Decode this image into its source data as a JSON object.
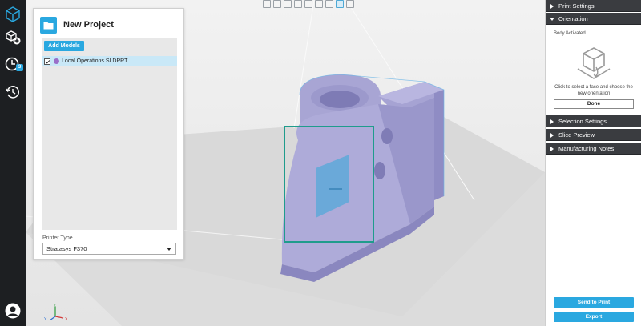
{
  "project": {
    "title": "New Project",
    "add_models_label": "Add Models",
    "model_file": "Local Operations.SLDPRT",
    "printer_type_label": "Printer Type",
    "printer_selected": "Stratasys F370"
  },
  "rail": {
    "history_badge": "3"
  },
  "right_panel": {
    "print_settings": "Print Settings",
    "orientation": "Orientation",
    "body_status": "Body Activated",
    "orientation_help": "Click to select a face and choose the new orientation",
    "done_label": "Done",
    "selection_settings": "Selection Settings",
    "slice_preview": "Slice Preview",
    "manufacturing_notes": "Manufacturing Notes",
    "send_to_print": "Send to Print",
    "export": "Export"
  },
  "triad": {
    "y": "Y",
    "z": "Z",
    "x": "X"
  },
  "colors": {
    "accent": "#2aa8e0",
    "part": "#aaa7d6",
    "selection": "#1f9c8c",
    "section_header": "#3a3c40"
  },
  "icons": {
    "rail": [
      "cube-icon",
      "add-part-icon",
      "history-icon",
      "restore-icon",
      "user-icon"
    ],
    "viewbar": [
      "view-front-icon",
      "view-back-icon",
      "view-left-icon",
      "view-right-icon",
      "view-top-icon",
      "view-bottom-icon",
      "view-fit-icon",
      "view-iso-icon",
      "view-camera-icon"
    ]
  }
}
